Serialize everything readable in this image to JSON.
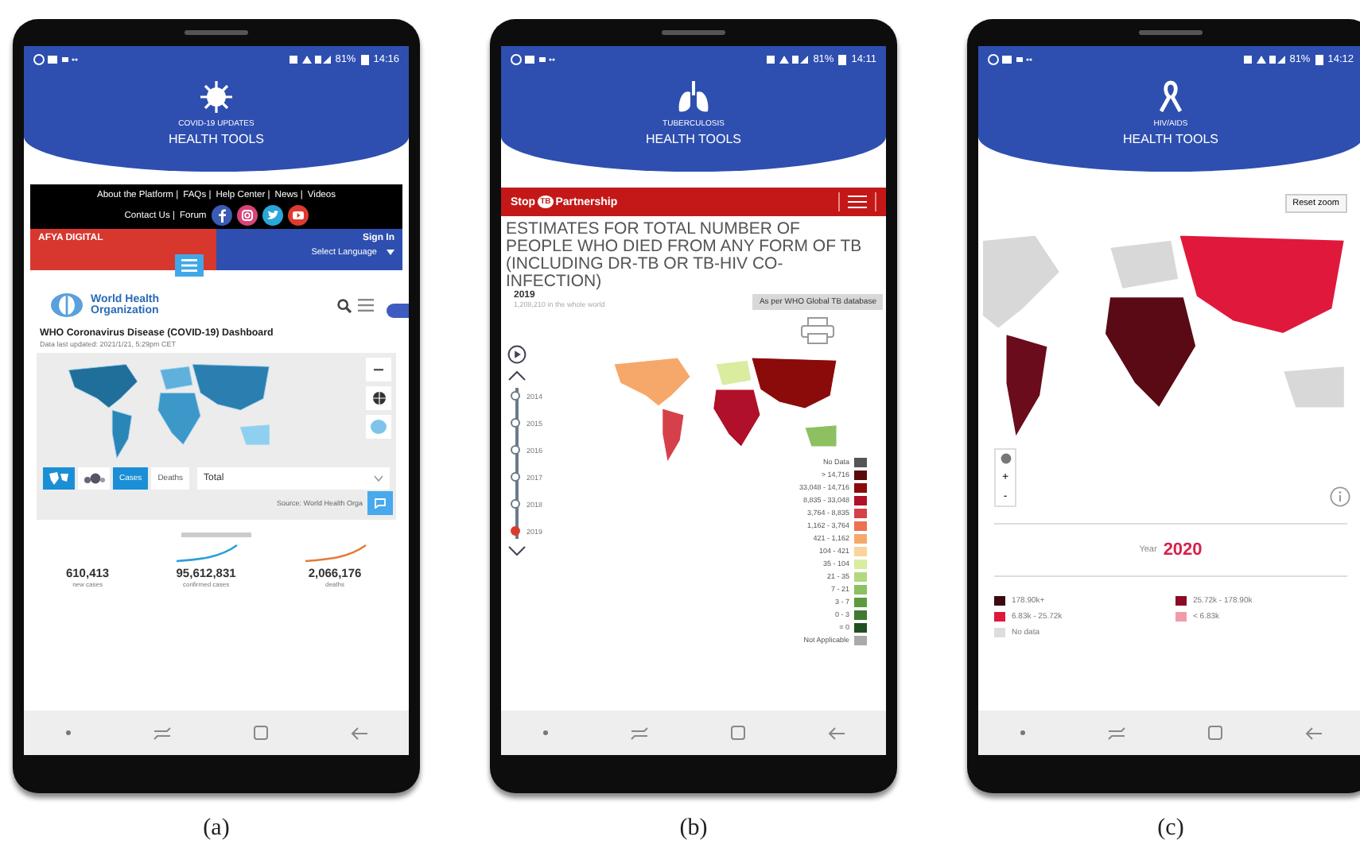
{
  "panels": [
    {
      "kind": "covid",
      "caption": "(a)",
      "status": {
        "battery": "81%",
        "time": "14:16"
      },
      "header": {
        "subtitle": "COVID-19 UPDATES",
        "title": "HEALTH TOOLS"
      },
      "top_links": [
        "About the Platform |",
        "FAQs |",
        "Help Center |",
        "News |",
        "Videos"
      ],
      "bottom_links": [
        "Contact Us |",
        "Forum"
      ],
      "brand_bar": {
        "logo": "AFYA DIGITAL",
        "sign_in": "Sign In",
        "language": "Select Language"
      },
      "who_logo": "World Health Organization",
      "dashboard": {
        "title": "WHO Coronavirus Disease (COVID-19) Dashboard",
        "updated": "Data last updated: 2021/1/21, 5:29pm CET",
        "toggles": [
          {
            "label": "Cases",
            "selected": true
          },
          {
            "label": "Deaths",
            "selected": false
          }
        ],
        "dropdown": "Total",
        "source": "Source: World Health Orga"
      },
      "stats": [
        {
          "value": "610,413",
          "label": "new cases"
        },
        {
          "value": "95,612,831",
          "label": "confirmed cases"
        },
        {
          "value": "2,066,176",
          "label": "deaths"
        }
      ]
    },
    {
      "kind": "tb",
      "caption": "(b)",
      "status": {
        "battery": "81%",
        "time": "14:11"
      },
      "header": {
        "subtitle": "TUBERCULOSIS",
        "title": "HEALTH TOOLS"
      },
      "brand": {
        "left": "Stop",
        "mark": "TB",
        "right": "Partnership"
      },
      "title": "ESTIMATES FOR TOTAL NUMBER OF PEOPLE WHO DIED FROM ANY FORM OF TB (INCLUDING DR-TB OR TB-HIV CO-INFECTION)",
      "source_button": "As per WHO Global TB database",
      "year": "2019",
      "total": "1,208,210 in the whole world",
      "years": [
        {
          "label": "2014",
          "selected": false
        },
        {
          "label": "2015",
          "selected": false
        },
        {
          "label": "2016",
          "selected": false
        },
        {
          "label": "2017",
          "selected": false
        },
        {
          "label": "2018",
          "selected": false
        },
        {
          "label": "2019",
          "selected": true
        }
      ],
      "legend": [
        {
          "label": "No Data",
          "color": "#555555"
        },
        {
          "label": "> 14,716",
          "color": "#5a0a0a"
        },
        {
          "label": "33,048 - 14,716",
          "color": "#8b0a0a"
        },
        {
          "label": "8,835 - 33,048",
          "color": "#b0102a"
        },
        {
          "label": "3,764 - 8,835",
          "color": "#d6404a"
        },
        {
          "label": "1,162 - 3,764",
          "color": "#ee7050"
        },
        {
          "label": "421 - 1,162",
          "color": "#f6a86a"
        },
        {
          "label": "104 - 421",
          "color": "#fad49a"
        },
        {
          "label": "35 - 104",
          "color": "#d9eca0"
        },
        {
          "label": "21 - 35",
          "color": "#b2d880"
        },
        {
          "label": "7 - 21",
          "color": "#8cc060"
        },
        {
          "label": "3 - 7",
          "color": "#5e9a40"
        },
        {
          "label": "0 - 3",
          "color": "#3e7a30"
        },
        {
          "label": "= 0",
          "color": "#204f20"
        },
        {
          "label": "Not Applicable",
          "color": "#aaaaaa"
        }
      ]
    },
    {
      "kind": "hiv",
      "caption": "(c)",
      "status": {
        "battery": "81%",
        "time": "14:12"
      },
      "header": {
        "subtitle": "HIV/AIDS",
        "title": "HEALTH TOOLS"
      },
      "reset": "Reset zoom",
      "zoom_controls": [
        "+",
        "-"
      ],
      "year_label": "Year",
      "year": "2020",
      "legend": [
        {
          "label": "178.90k+",
          "color": "#3d0a12"
        },
        {
          "label": "25.72k - 178.90k",
          "color": "#8a0c24"
        },
        {
          "label": "6.83k - 25.72k",
          "color": "#e0183c"
        },
        {
          "label": "< 6.83k",
          "color": "#f29aaa"
        },
        {
          "label": "No data",
          "color": "#dddddd"
        }
      ]
    }
  ]
}
